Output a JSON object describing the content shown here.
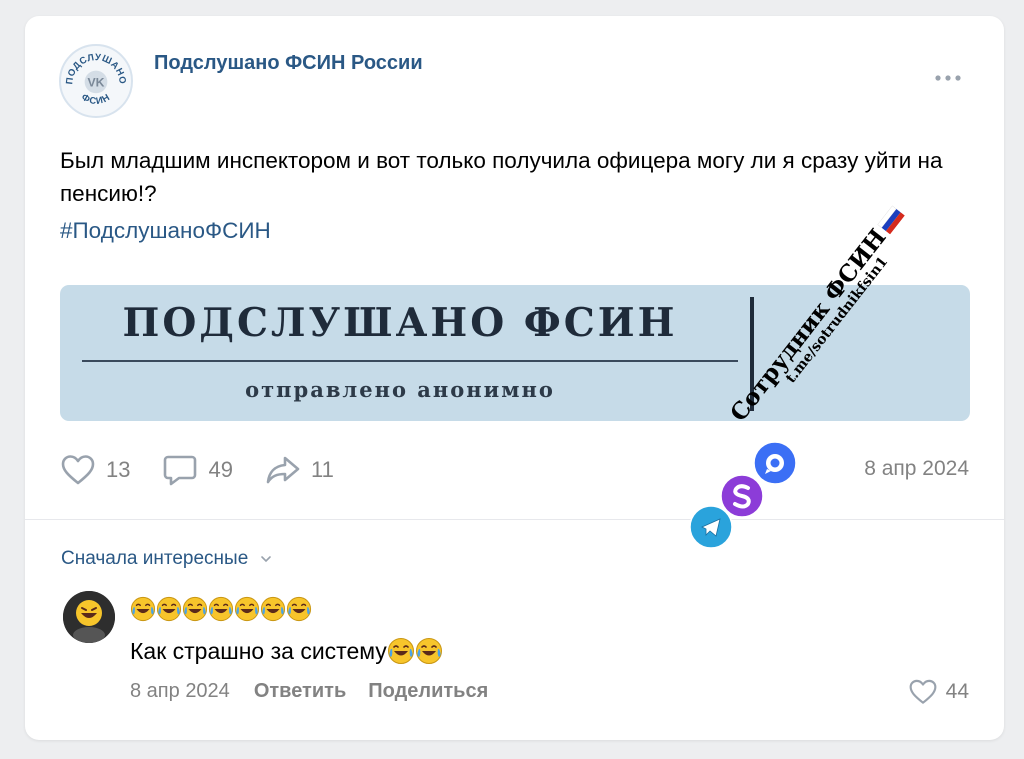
{
  "post": {
    "group_name": "Подслушано ФСИН России",
    "avatar_text": {
      "top": "ПОДСЛУШАНО",
      "center": "VK",
      "bottom": "ФСИН"
    },
    "text": "Был младшим инспектором и вот только получила офицера могу ли я сразу уйти на пенсию!?",
    "hashtag": "#ПодслушаноФСИН",
    "banner": {
      "title": "ПОДСЛУШАНО ФСИН",
      "subtitle": "отправлено анонимно"
    },
    "actions": {
      "likes": "13",
      "comments": "49",
      "shares": "11"
    },
    "date": "8 апр 2024",
    "colors": {
      "link": "#2a5885",
      "muted": "#828282",
      "banner": "#c6dbe8"
    }
  },
  "comments_section": {
    "sort_label": "Сначала интересные"
  },
  "comment": {
    "author_emoji_count": 7,
    "text": "Как страшно за систему",
    "date": "8 апр 2024",
    "reply_label": "Ответить",
    "share_label": "Поделиться",
    "likes": "44"
  },
  "watermark": {
    "title": "Сотрудник ФСИН",
    "link": "t.me/sotrudnikfsin1",
    "icons": [
      "telegram-icon",
      "s-app-icon",
      "chat-app-icon",
      "russia-flag-icon"
    ]
  }
}
